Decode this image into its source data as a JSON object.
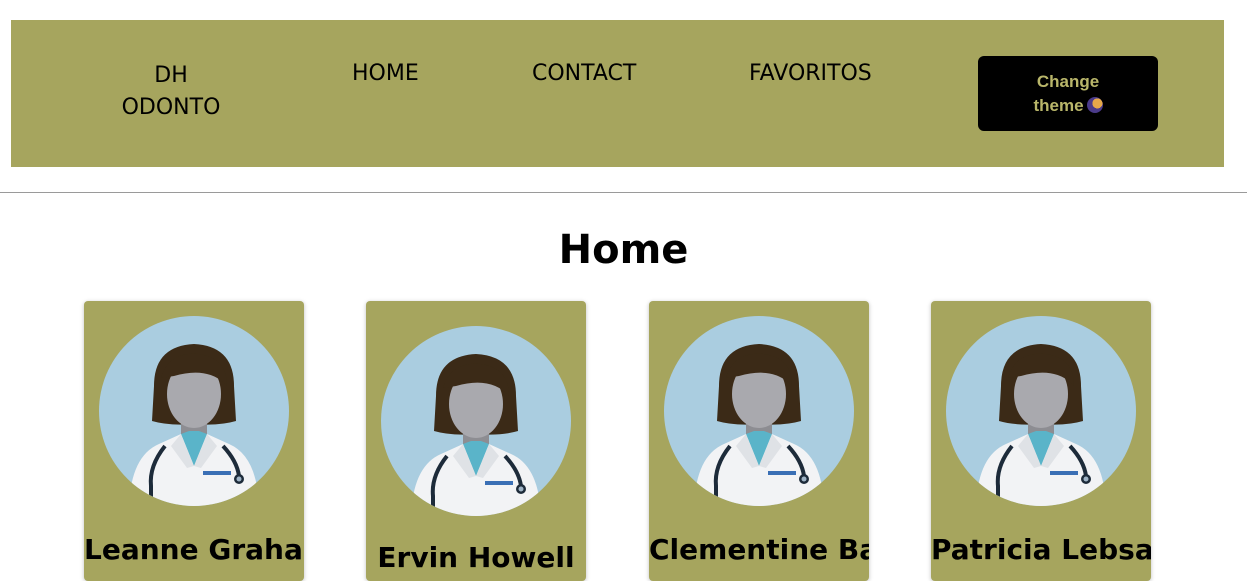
{
  "navbar": {
    "brand_line1": "DH",
    "brand_line2": "ODONTO",
    "links": [
      "HOME",
      "CONTACT",
      "FAVORITOS"
    ],
    "theme_button_line1": "Change",
    "theme_button_line2": "theme"
  },
  "main": {
    "title": "Home"
  },
  "cards": [
    {
      "name": "Leanne Graham"
    },
    {
      "name": "Ervin Howell"
    },
    {
      "name": "Clementine Bauch"
    },
    {
      "name": "Patricia Lebsack"
    }
  ],
  "colors": {
    "accent": "#a6a55e",
    "button_bg": "#000000",
    "button_text": "#b9b66a"
  }
}
